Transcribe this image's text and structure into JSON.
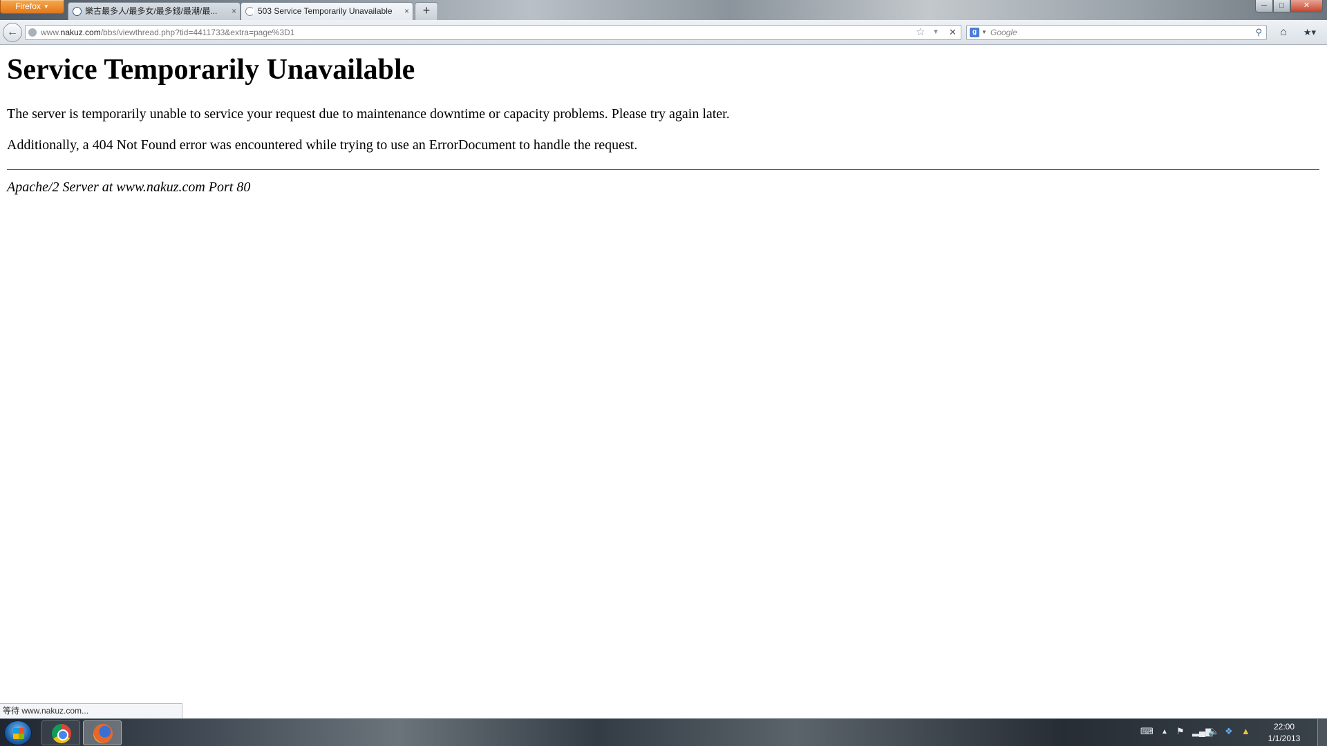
{
  "browser": {
    "menu_button_label": "Firefox",
    "tabs": [
      {
        "title": "樂古最多人/最多女/最多錢/最潮/最...",
        "active": false
      },
      {
        "title": "503 Service Temporarily Unavailable",
        "active": true
      }
    ],
    "new_tab_label": "+",
    "close_glyph": "×"
  },
  "navbar": {
    "url_host_prefix": "www.",
    "url_host": "nakuz.com",
    "url_path": "/bbs/viewthread.php?tid=4411733&extra=page%3D1",
    "search_placeholder": "Google",
    "search_value": ""
  },
  "page": {
    "title": "Service Temporarily Unavailable",
    "paragraph_1": "The server is temporarily unable to service your request due to maintenance downtime or capacity problems. Please try again later.",
    "paragraph_2": "Additionally, a 404 Not Found error was encountered while trying to use an ErrorDocument to handle the request.",
    "server_signature": "Apache/2 Server at www.nakuz.com Port 80"
  },
  "status": {
    "text": "等待 www.nakuz.com..."
  },
  "taskbar": {
    "apps": [
      "chrome",
      "firefox"
    ],
    "clock_time": "22:00",
    "clock_date": "1/1/2013"
  },
  "colors": {
    "firefox_button": "#e2761b",
    "page_background": "#ffffff",
    "page_text": "#000000"
  }
}
